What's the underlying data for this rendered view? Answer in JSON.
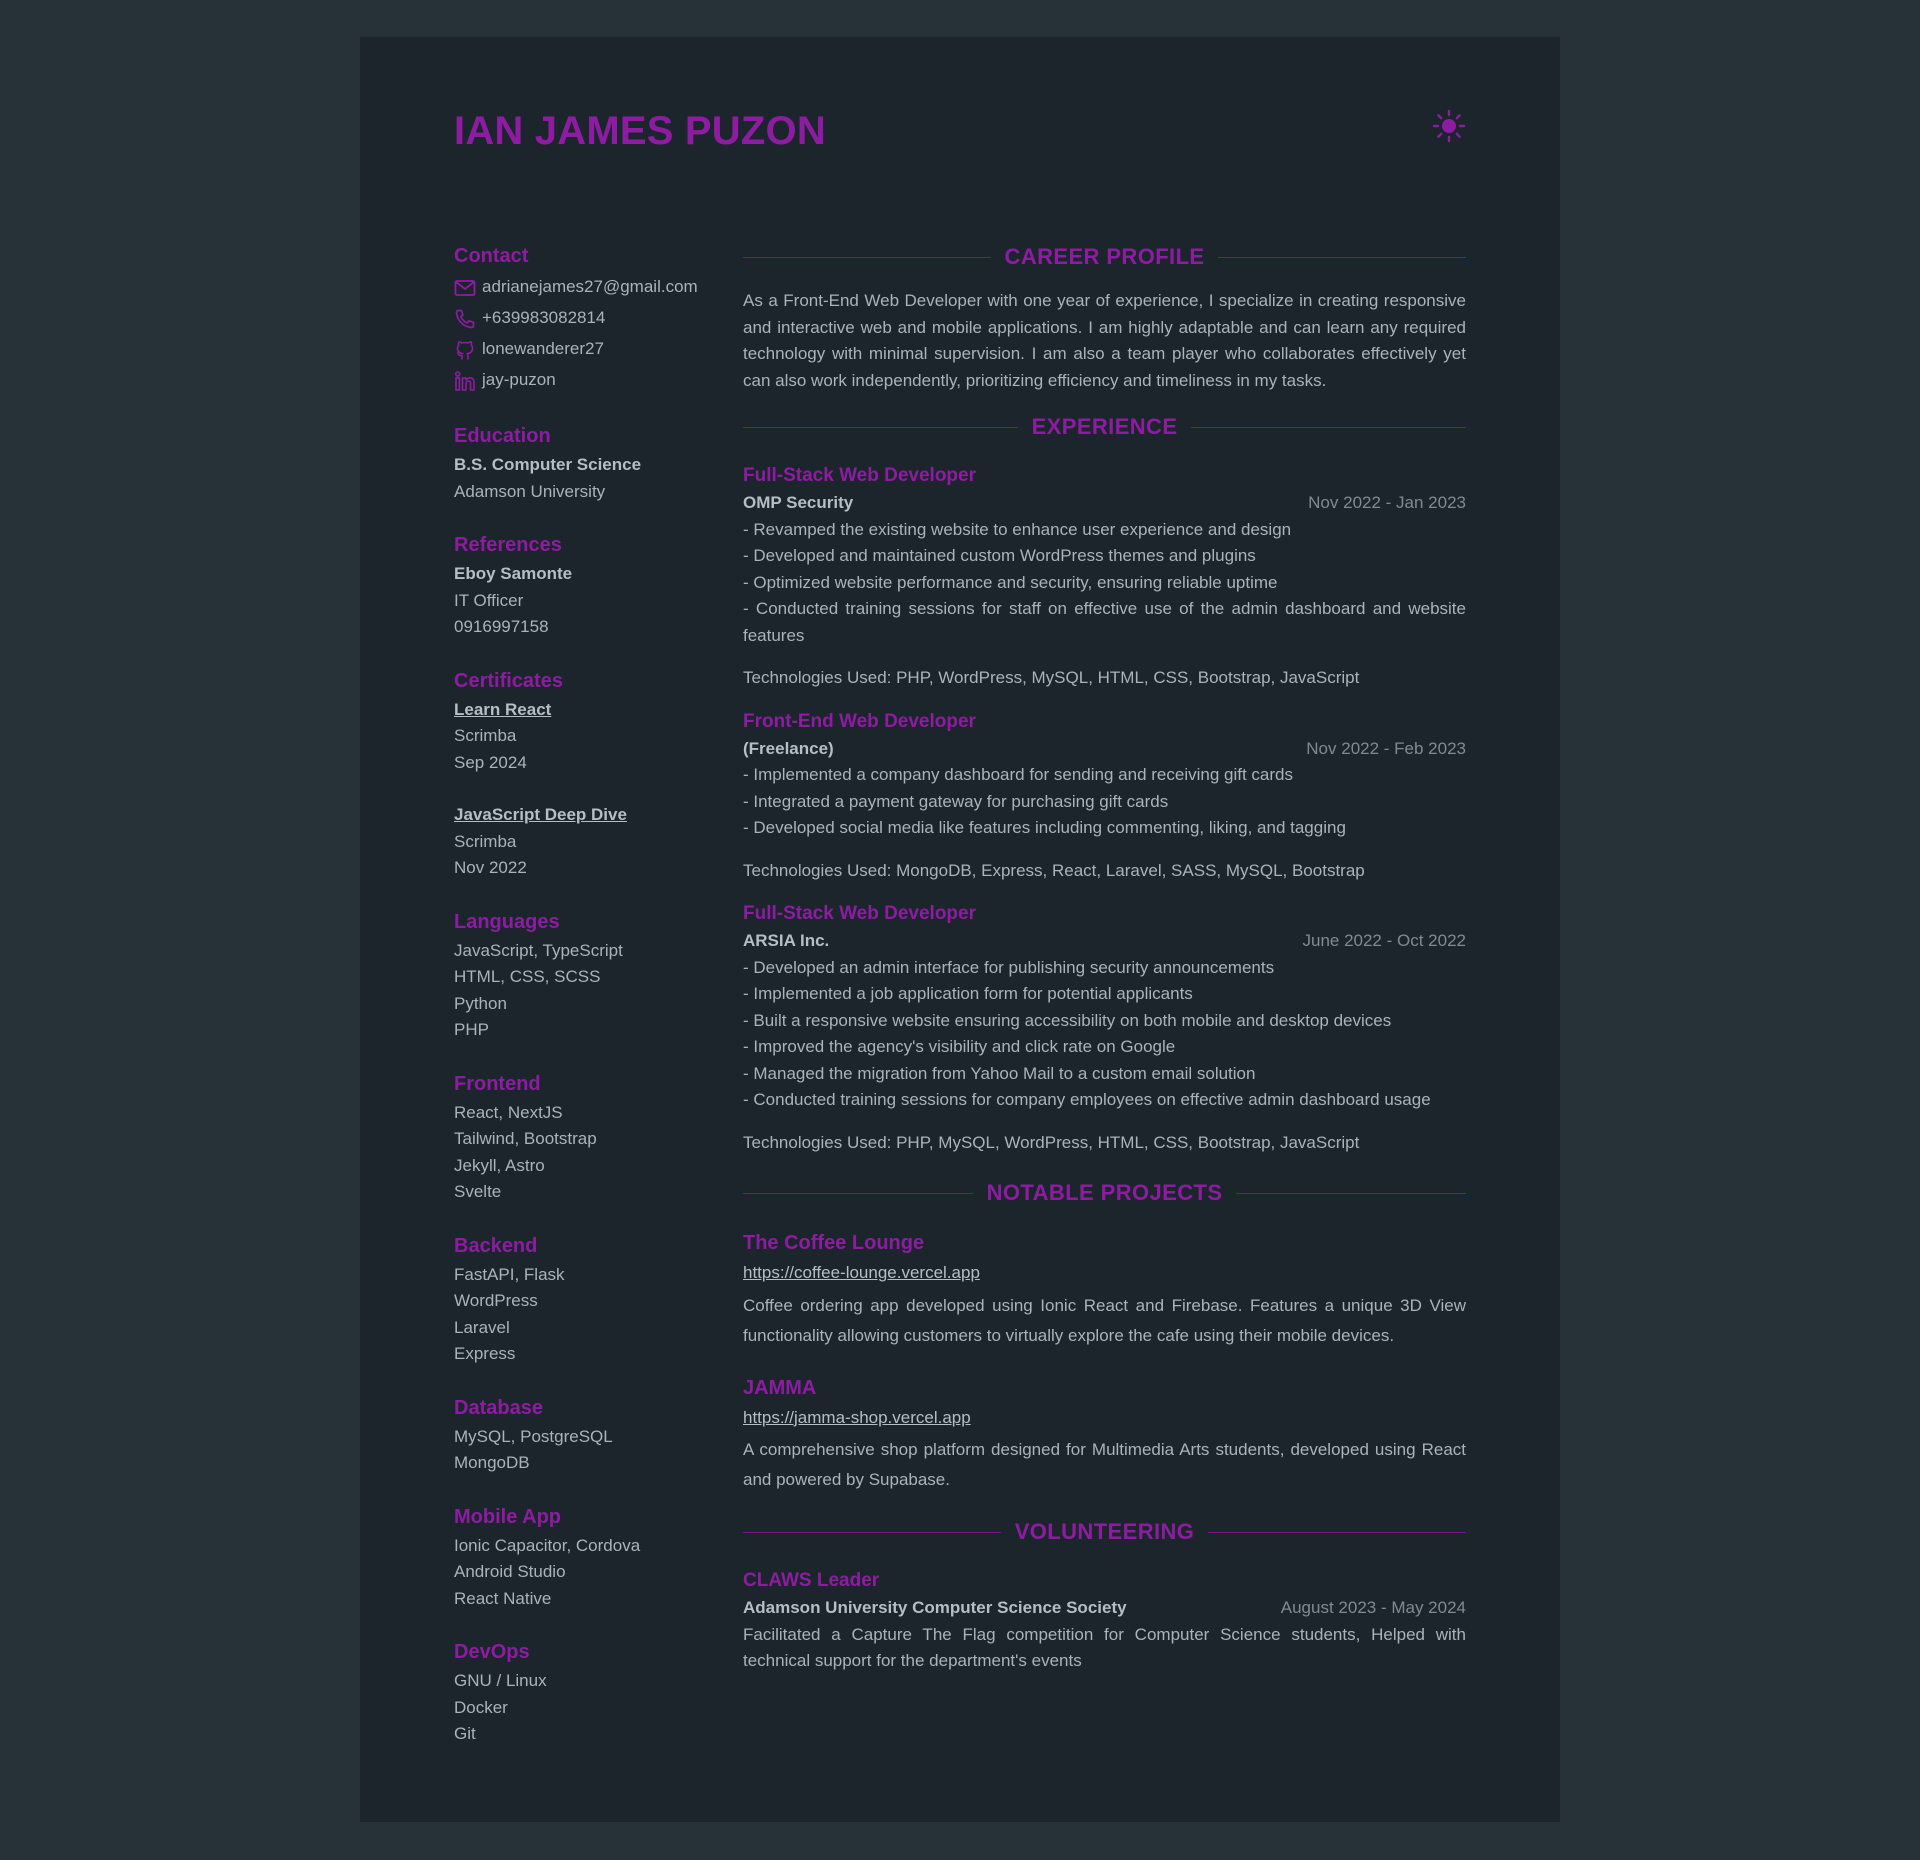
{
  "header": {
    "name": "IAN JAMES PUZON",
    "theme_toggle_icon": "sun-icon"
  },
  "colors": {
    "background": "#263238",
    "page": "#1c252c",
    "accent": "#8e1ca3",
    "text": "#a9b3ba"
  },
  "contact": {
    "title": "Contact",
    "email": "adrianejames27@gmail.com",
    "phone": "+639983082814",
    "github": "lonewanderer27",
    "linkedin": "jay-puzon"
  },
  "education": {
    "title": "Education",
    "degree": "B.S. Computer Science",
    "school": "Adamson University"
  },
  "references": {
    "title": "References",
    "name": "Eboy Samonte",
    "role": "IT Officer",
    "phone": "0916997158"
  },
  "certificates": {
    "title": "Certificates",
    "items": [
      {
        "name": "Learn React",
        "issuer": "Scrimba",
        "date": "Sep 2024"
      },
      {
        "name": "JavaScript Deep Dive",
        "issuer": "Scrimba",
        "date": "Nov 2022"
      }
    ]
  },
  "skills": [
    {
      "title": "Languages",
      "items": [
        "JavaScript, TypeScript",
        "HTML, CSS, SCSS",
        "Python",
        "PHP"
      ]
    },
    {
      "title": "Frontend",
      "items": [
        "React, NextJS",
        "Tailwind, Bootstrap",
        "Jekyll, Astro",
        "Svelte"
      ]
    },
    {
      "title": "Backend",
      "items": [
        "FastAPI, Flask",
        "WordPress",
        "Laravel",
        "Express"
      ]
    },
    {
      "title": "Database",
      "items": [
        "MySQL, PostgreSQL",
        "MongoDB"
      ]
    },
    {
      "title": "Mobile App",
      "items": [
        "Ionic Capacitor, Cordova",
        "Android Studio",
        "React Native"
      ]
    },
    {
      "title": "DevOps",
      "items": [
        "GNU / Linux",
        "Docker",
        "Git"
      ]
    }
  ],
  "career_profile": {
    "title": "CAREER PROFILE",
    "text": "As a Front-End Web Developer with one year of experience, I specialize in creating responsive and interactive web and mobile applications. I am highly adaptable and can learn any required technology with minimal supervision. I am also a team player who collaborates effectively yet can also work independently, prioritizing efficiency and timeliness in my tasks."
  },
  "experience": {
    "title": "EXPERIENCE",
    "jobs": [
      {
        "title": "Full-Stack Web Developer",
        "company": "OMP Security",
        "date": "Nov 2022 - Jan 2023",
        "bullets": [
          "- Revamped the existing website to enhance user experience and design",
          "- Developed and maintained custom WordPress themes and plugins",
          "- Optimized website performance and security, ensuring reliable uptime",
          "- Conducted training sessions for staff on effective use of the admin dashboard and website features"
        ],
        "tech": "Technologies Used: PHP, WordPress, MySQL, HTML, CSS, Bootstrap, JavaScript"
      },
      {
        "title": "Front-End Web Developer",
        "company": "(Freelance)",
        "date": "Nov 2022 - Feb 2023",
        "bullets": [
          "- Implemented a company dashboard for sending and receiving gift cards",
          "- Integrated a payment gateway for purchasing gift cards",
          "- Developed social media like features including commenting, liking, and tagging"
        ],
        "tech": "Technologies Used: MongoDB, Express, React, Laravel, SASS, MySQL, Bootstrap"
      },
      {
        "title": "Full-Stack Web Developer",
        "company": "ARSIA Inc.",
        "date": "June 2022 - Oct 2022",
        "bullets": [
          "- Developed an admin interface for publishing security announcements",
          "- Implemented a job application form for potential applicants",
          "- Built a responsive website ensuring accessibility on both mobile and desktop devices",
          "- Improved the agency's visibility and click rate on Google",
          "- Managed the migration from Yahoo Mail to a custom email solution",
          "- Conducted training sessions for company employees on effective admin dashboard usage"
        ],
        "tech": "Technologies Used: PHP, MySQL, WordPress, HTML, CSS, Bootstrap, JavaScript"
      }
    ]
  },
  "projects": {
    "title": "NOTABLE PROJECTS",
    "items": [
      {
        "title": "The Coffee Lounge",
        "url": "https://coffee-lounge.vercel.app",
        "desc": "Coffee ordering app developed using Ionic React and Firebase. Features a unique 3D View functionality allowing customers to virtually explore the cafe using their mobile devices."
      },
      {
        "title": "JAMMA",
        "url": "https://jamma-shop.vercel.app",
        "desc": "A comprehensive shop platform designed for Multimedia Arts students, developed using React and powered by Supabase."
      }
    ]
  },
  "volunteering": {
    "title": "VOLUNTEERING",
    "role": "CLAWS Leader",
    "org": "Adamson University Computer Science Society",
    "date": "August 2023 - May 2024",
    "text": "Facilitated a Capture The Flag competition for Computer Science students, Helped with technical support for the department's events"
  }
}
